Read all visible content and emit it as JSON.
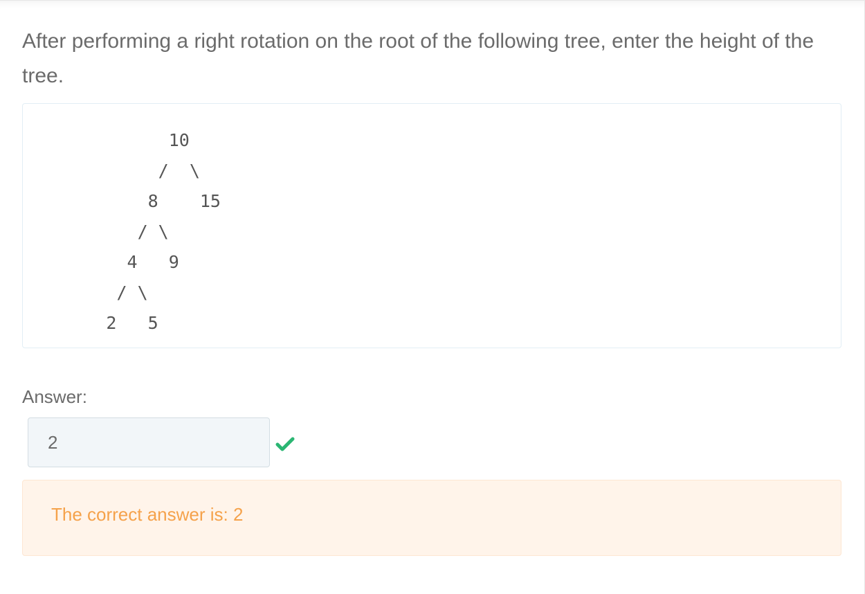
{
  "question": {
    "prompt": "After performing a right rotation on the root of the following tree, enter the height of the tree."
  },
  "tree_diagram": {
    "text": "              10\n             /  \\\n            8    15\n           / \\\n          4   9\n         / \\\n        2   5"
  },
  "answer": {
    "label": "Answer:",
    "value": "2",
    "status_icon": "checkmark-icon",
    "status_color": "#2bb673"
  },
  "feedback": {
    "text": "The correct answer is: 2",
    "text_color": "#f5a24b",
    "background_color": "#fff4ea"
  }
}
